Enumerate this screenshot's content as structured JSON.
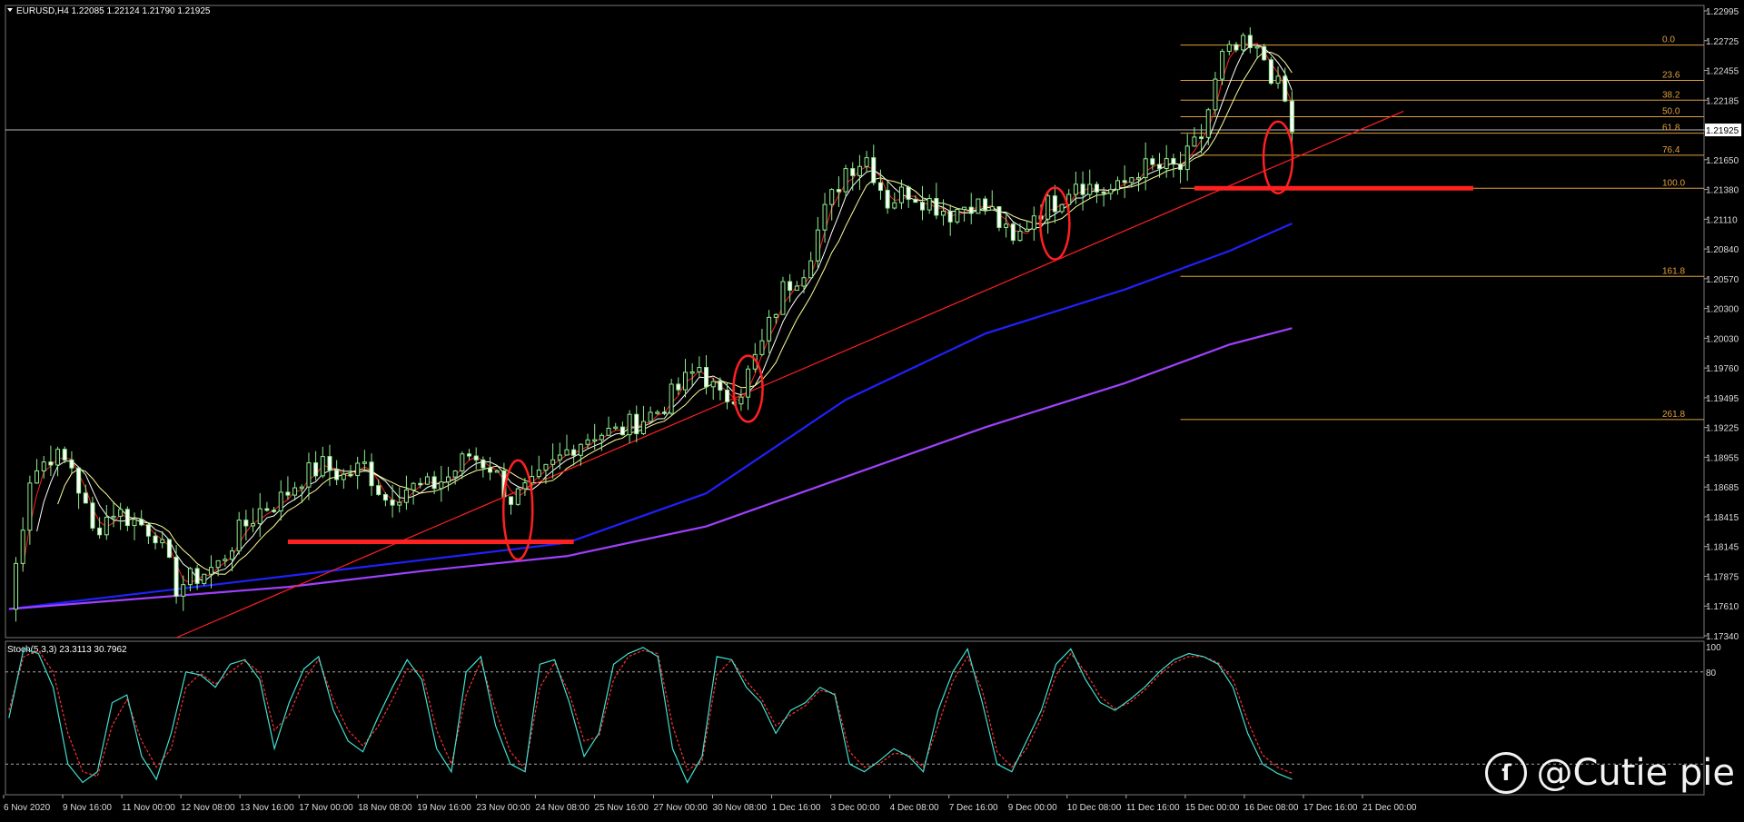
{
  "header": {
    "symbol_line": "EURUSD,H4  1.22085 1.22124 1.21790 1.21925",
    "current_price": "1.21925"
  },
  "indicator": {
    "label": "Stoch(5,3,3) 23.3113 30.7962",
    "levels": [
      "100",
      "80"
    ]
  },
  "fibonacci_labels": [
    "0.0",
    "23.6",
    "38.2",
    "50.0",
    "61.8",
    "76.4",
    "100.0",
    "161.8",
    "261.8"
  ],
  "watermark": {
    "text": "@Cutie pie"
  },
  "colors": {
    "background": "#000000",
    "bull_candle": "#90ee90",
    "bear_candle": "#ffffff",
    "ma_fast": "#ff2020",
    "ma_mid": "#ffffff",
    "ma_slow": "#ffff99",
    "ma_100": "#2020ff",
    "ma_200": "#a040ff",
    "fib": "#e0a040",
    "trendline": "#ff2020",
    "highlight": "#ff2020",
    "stoch_main": "#40e0d0",
    "stoch_signal": "#ff3030"
  },
  "chart_data": {
    "type": "candlestick",
    "symbol": "EURUSD",
    "timeframe": "H4",
    "ohlc_last": {
      "open": 1.22085,
      "high": 1.22124,
      "low": 1.2179,
      "close": 1.21925
    },
    "y_ticks": [
      "1.22995",
      "1.22725",
      "1.22455",
      "1.22185",
      "1.21925",
      "1.21650",
      "1.21380",
      "1.21110",
      "1.20840",
      "1.20570",
      "1.20300",
      "1.20030",
      "1.19760",
      "1.19495",
      "1.19225",
      "1.18955",
      "1.18685",
      "1.18415",
      "1.18145",
      "1.17875",
      "1.17610",
      "1.17340"
    ],
    "ylim": [
      1.1734,
      1.2308
    ],
    "x_ticks": [
      "6 Nov 2020",
      "9 Nov 16:00",
      "11 Nov 00:00",
      "12 Nov 08:00",
      "13 Nov 16:00",
      "17 Nov 00:00",
      "18 Nov 08:00",
      "19 Nov 16:00",
      "23 Nov 00:00",
      "24 Nov 08:00",
      "25 Nov 16:00",
      "27 Nov 00:00",
      "30 Nov 08:00",
      "1 Dec 16:00",
      "3 Dec 00:00",
      "4 Dec 08:00",
      "7 Dec 16:00",
      "9 Dec 00:00",
      "10 Dec 08:00",
      "11 Dec 16:00",
      "15 Dec 00:00",
      "16 Dec 08:00",
      "17 Dec 16:00",
      "21 Dec 00:00"
    ],
    "close_path": [
      [
        0,
        1.176
      ],
      [
        3,
        1.188
      ],
      [
        6,
        1.19
      ],
      [
        9,
        1.189
      ],
      [
        12,
        1.183
      ],
      [
        15,
        1.185
      ],
      [
        18,
        1.184
      ],
      [
        21,
        1.183
      ],
      [
        24,
        1.178
      ],
      [
        27,
        1.179
      ],
      [
        30,
        1.18
      ],
      [
        33,
        1.183
      ],
      [
        36,
        1.185
      ],
      [
        39,
        1.186
      ],
      [
        42,
        1.188
      ],
      [
        45,
        1.189
      ],
      [
        48,
        1.188
      ],
      [
        51,
        1.189
      ],
      [
        54,
        1.186
      ],
      [
        57,
        1.187
      ],
      [
        60,
        1.187
      ],
      [
        63,
        1.188
      ],
      [
        66,
        1.19
      ],
      [
        69,
        1.189
      ],
      [
        72,
        1.186
      ],
      [
        75,
        1.187
      ],
      [
        78,
        1.189
      ],
      [
        81,
        1.191
      ],
      [
        84,
        1.192
      ],
      [
        87,
        1.192
      ],
      [
        90,
        1.193
      ],
      [
        93,
        1.194
      ],
      [
        96,
        1.196
      ],
      [
        99,
        1.198
      ],
      [
        102,
        1.195
      ],
      [
        105,
        1.196
      ],
      [
        108,
        1.2
      ],
      [
        111,
        1.205
      ],
      [
        114,
        1.207
      ],
      [
        117,
        1.212
      ],
      [
        120,
        1.216
      ],
      [
        123,
        1.217
      ],
      [
        126,
        1.213
      ],
      [
        129,
        1.214
      ],
      [
        132,
        1.213
      ],
      [
        135,
        1.212
      ],
      [
        138,
        1.213
      ],
      [
        141,
        1.212
      ],
      [
        144,
        1.209
      ],
      [
        147,
        1.212
      ],
      [
        150,
        1.213
      ],
      [
        153,
        1.215
      ],
      [
        156,
        1.214
      ],
      [
        159,
        1.214
      ],
      [
        162,
        1.216
      ],
      [
        165,
        1.216
      ],
      [
        168,
        1.216
      ],
      [
        171,
        1.219
      ],
      [
        174,
        1.226
      ],
      [
        177,
        1.227
      ],
      [
        180,
        1.226
      ],
      [
        183,
        1.222
      ],
      [
        184,
        1.219
      ]
    ],
    "moving_averages": [
      {
        "period": "fast",
        "color": "#ff2020",
        "lag": 2
      },
      {
        "period": "mid",
        "color": "#ffffff",
        "lag": 4
      },
      {
        "period": "slow",
        "color": "#ffff99",
        "lag": 7
      },
      {
        "period": "100",
        "points": [
          [
            0,
            1.176
          ],
          [
            20,
            1.1775
          ],
          [
            40,
            1.179
          ],
          [
            60,
            1.1805
          ],
          [
            80,
            1.182
          ],
          [
            100,
            1.1865
          ],
          [
            120,
            1.195
          ],
          [
            140,
            1.201
          ],
          [
            160,
            1.205
          ],
          [
            175,
            1.2085
          ],
          [
            184,
            1.211
          ]
        ],
        "color": "#2020ff"
      },
      {
        "period": "200",
        "points": [
          [
            0,
            1.176
          ],
          [
            20,
            1.177
          ],
          [
            40,
            1.178
          ],
          [
            60,
            1.1795
          ],
          [
            80,
            1.1808
          ],
          [
            100,
            1.1835
          ],
          [
            120,
            1.188
          ],
          [
            140,
            1.1925
          ],
          [
            160,
            1.1965
          ],
          [
            175,
            1.2
          ],
          [
            184,
            1.2015
          ]
        ],
        "color": "#a040ff"
      }
    ],
    "fib_levels": [
      {
        "label": "0.0",
        "price": 1.2272
      },
      {
        "label": "23.6",
        "price": 1.224
      },
      {
        "label": "38.2",
        "price": 1.2222
      },
      {
        "label": "50.0",
        "price": 1.2207
      },
      {
        "label": "61.8",
        "price": 1.2192
      },
      {
        "label": "76.4",
        "price": 1.2172
      },
      {
        "label": "100.0",
        "price": 1.2142
      },
      {
        "label": "161.8",
        "price": 1.2062
      },
      {
        "label": "261.8",
        "price": 1.1932
      }
    ],
    "trendline": {
      "from": [
        24,
        1.1734
      ],
      "to": [
        200,
        1.2212
      ]
    },
    "horizontal_marks": [
      {
        "from": 40,
        "to": 81,
        "price": 1.1821
      },
      {
        "from": 170,
        "to": 210,
        "price": 1.2142
      }
    ],
    "ellipses": [
      {
        "center": [
          73,
          1.185
        ],
        "price_span": 0.009
      },
      {
        "center": [
          106,
          1.196
        ],
        "price_span": 0.006
      },
      {
        "center": [
          150,
          1.211
        ],
        "price_span": 0.0065
      },
      {
        "center": [
          182,
          1.217
        ],
        "price_span": 0.0065
      }
    ],
    "stochastic": {
      "k": [
        50,
        95,
        92,
        70,
        20,
        8,
        15,
        60,
        65,
        25,
        10,
        40,
        80,
        78,
        70,
        85,
        88,
        75,
        30,
        60,
        82,
        90,
        55,
        35,
        28,
        50,
        70,
        88,
        75,
        30,
        15,
        80,
        90,
        45,
        20,
        15,
        85,
        88,
        60,
        25,
        40,
        85,
        92,
        96,
        90,
        30,
        8,
        25,
        90,
        88,
        70,
        60,
        40,
        55,
        60,
        70,
        65,
        20,
        15,
        22,
        30,
        25,
        15,
        55,
        80,
        95,
        60,
        20,
        15,
        35,
        55,
        85,
        95,
        75,
        60,
        55,
        62,
        70,
        80,
        88,
        92,
        90,
        85,
        70,
        40,
        20,
        14,
        10
      ],
      "d": [
        55,
        90,
        94,
        80,
        40,
        15,
        12,
        45,
        62,
        35,
        18,
        30,
        70,
        79,
        72,
        80,
        87,
        80,
        42,
        52,
        75,
        88,
        62,
        42,
        32,
        44,
        62,
        82,
        80,
        42,
        20,
        65,
        87,
        55,
        28,
        17,
        70,
        86,
        66,
        35,
        38,
        75,
        90,
        94,
        92,
        45,
        16,
        22,
        78,
        88,
        74,
        63,
        45,
        52,
        58,
        68,
        66,
        28,
        18,
        20,
        27,
        26,
        18,
        45,
        74,
        90,
        68,
        28,
        18,
        30,
        50,
        78,
        92,
        80,
        64,
        56,
        60,
        68,
        78,
        86,
        90,
        90,
        86,
        75,
        48,
        26,
        18,
        14
      ]
    }
  }
}
